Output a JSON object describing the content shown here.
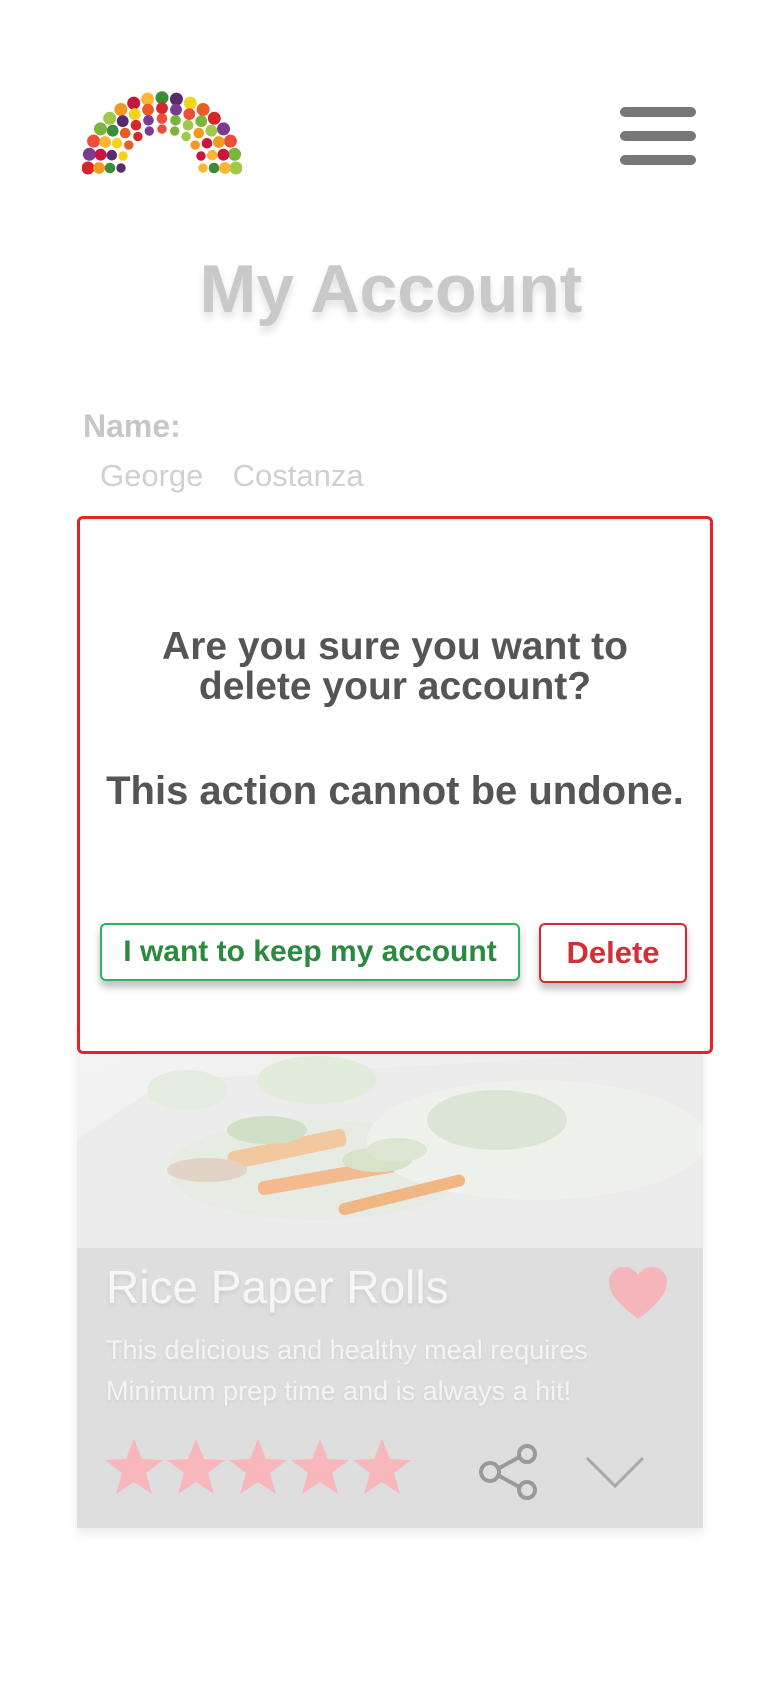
{
  "header": {
    "logo_icon": "fruit-vegetable-rainbow-logo",
    "menu_icon": "hamburger-menu-icon"
  },
  "page": {
    "title": "My Account",
    "name_label": "Name:",
    "name_value": "George  Costanza"
  },
  "dialog": {
    "question": "Are you sure you want to delete your account?",
    "warning": "This action cannot be undone.",
    "keep_label": "I want to keep my account",
    "delete_label": "Delete",
    "border_color": "#e02525",
    "keep_color": "#2a8a3e",
    "delete_color": "#d03038"
  },
  "recipe_card": {
    "title": "Rice Paper Rolls",
    "description": "This delicious and healthy meal requires Minimum prep time and is always a hit!",
    "rating": 5,
    "rating_max": 5,
    "favorite_icon": "heart-icon",
    "share_icon": "share-icon",
    "expand_icon": "chevron-down-icon",
    "accent_color": "#f7b7bb"
  }
}
